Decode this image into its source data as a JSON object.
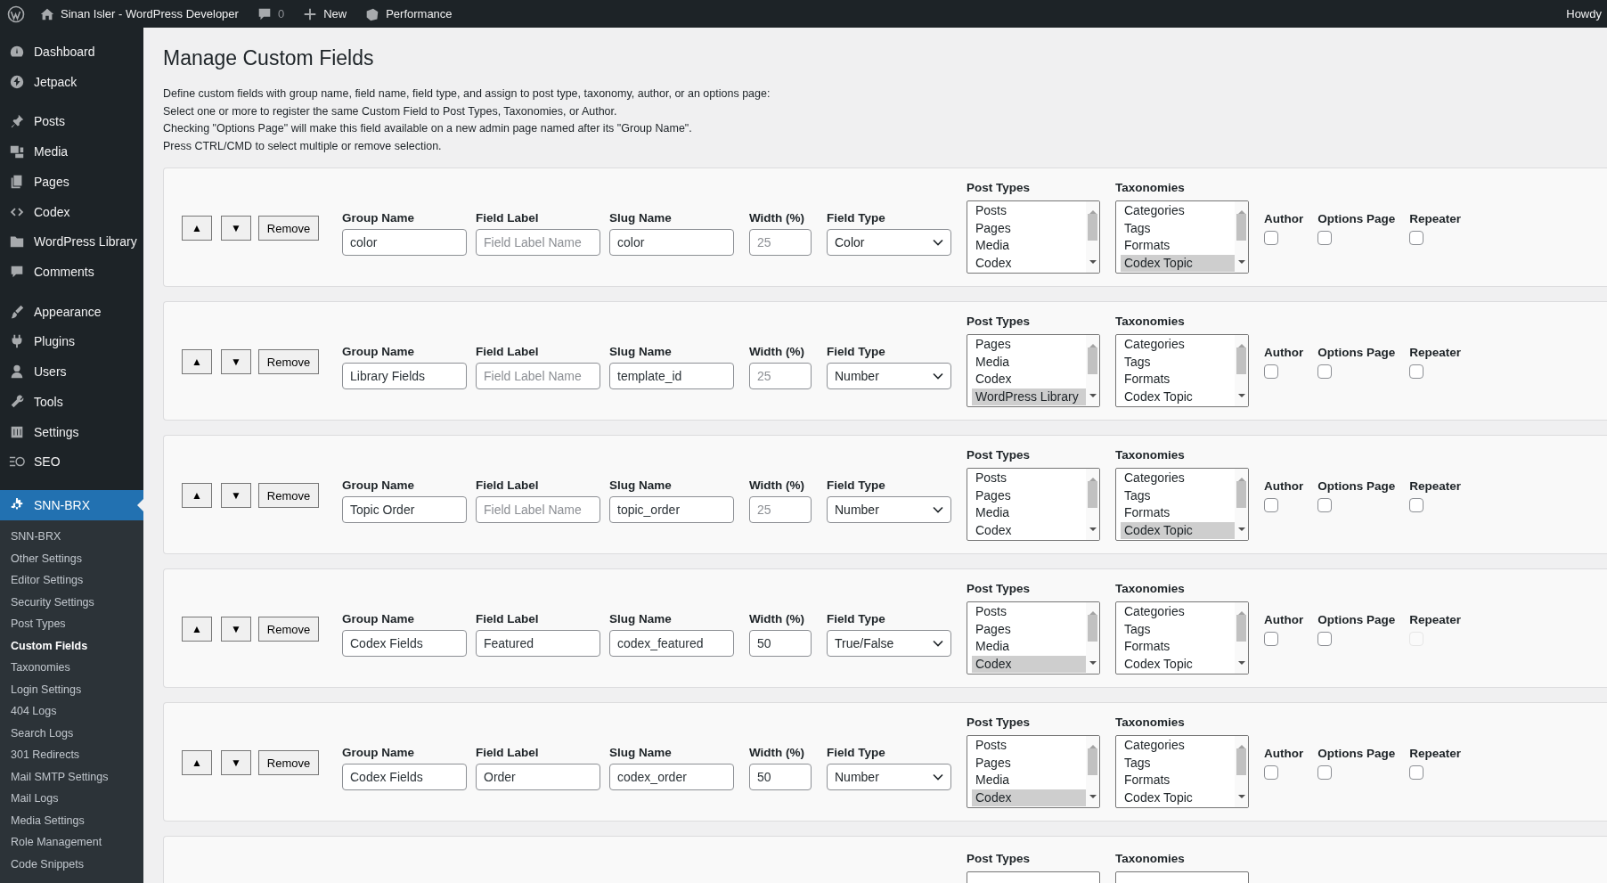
{
  "admin_bar": {
    "site_name": "Sinan Isler - WordPress Developer",
    "comments_count": "0",
    "new_label": "New",
    "performance_label": "Performance",
    "howdy": "Howdy"
  },
  "sidebar": {
    "groups": [
      [
        {
          "label": "Dashboard",
          "kind": "dashboard",
          "selected": false
        },
        {
          "label": "Jetpack",
          "kind": "jetpack",
          "selected": false
        }
      ],
      [
        {
          "label": "Posts",
          "kind": "posts",
          "selected": false
        },
        {
          "label": "Media",
          "kind": "media",
          "selected": false
        },
        {
          "label": "Pages",
          "kind": "pages",
          "selected": false
        },
        {
          "label": "Codex",
          "kind": "codex",
          "selected": false
        },
        {
          "label": "WordPress Library",
          "kind": "library",
          "selected": false
        },
        {
          "label": "Comments",
          "kind": "comments",
          "selected": false
        }
      ],
      [
        {
          "label": "Appearance",
          "kind": "appearance",
          "selected": false
        },
        {
          "label": "Plugins",
          "kind": "plugins",
          "selected": false
        },
        {
          "label": "Users",
          "kind": "users",
          "selected": false
        },
        {
          "label": "Tools",
          "kind": "tools",
          "selected": false
        },
        {
          "label": "Settings",
          "kind": "settings",
          "selected": false
        },
        {
          "label": "SEO",
          "kind": "seo",
          "selected": false
        }
      ],
      [
        {
          "label": "SNN-BRX",
          "kind": "snn",
          "selected": true
        }
      ]
    ],
    "submenu": [
      {
        "label": "SNN-BRX",
        "selected": false
      },
      {
        "label": "Other Settings",
        "selected": false
      },
      {
        "label": "Editor Settings",
        "selected": false
      },
      {
        "label": "Security Settings",
        "selected": false
      },
      {
        "label": "Post Types",
        "selected": false
      },
      {
        "label": "Custom Fields",
        "selected": true
      },
      {
        "label": "Taxonomies",
        "selected": false
      },
      {
        "label": "Login Settings",
        "selected": false
      },
      {
        "label": "404 Logs",
        "selected": false
      },
      {
        "label": "Search Logs",
        "selected": false
      },
      {
        "label": "301 Redirects",
        "selected": false
      },
      {
        "label": "Mail SMTP Settings",
        "selected": false
      },
      {
        "label": "Mail Logs",
        "selected": false
      },
      {
        "label": "Media Settings",
        "selected": false
      },
      {
        "label": "Role Management",
        "selected": false
      },
      {
        "label": "Code Snippets",
        "selected": false
      }
    ]
  },
  "page": {
    "title": "Manage Custom Fields",
    "description": [
      "Define custom fields with group name, field name, field type, and assign to post type, taxonomy, author, or an options page:",
      "Select one or more to register the same Custom Field to Post Types, Taxonomies, or Author.",
      "Checking \"Options Page\" will make this field available on a new admin page named after its \"Group Name\".",
      "Press CTRL/CMD to select multiple or remove selection."
    ]
  },
  "cards": [
    {
      "kind": "full",
      "buttons": {
        "up": "▲",
        "down": "▼",
        "remove": "Remove"
      },
      "labels": {
        "group_name": "Group Name",
        "field_label": "Field Label",
        "slug_name": "Slug Name",
        "width": "Width (%)",
        "field_type": "Field Type",
        "post_types": "Post Types",
        "taxonomies": "Taxonomies",
        "author": "Author",
        "options_page": "Options Page",
        "repeater": "Repeater"
      },
      "group_name": {
        "value": "color"
      },
      "field_label": {
        "placeholder": "Field Label Name"
      },
      "slug_name": {
        "value": "color"
      },
      "width": {
        "placeholder": "25"
      },
      "field_type": "Color",
      "post_types": [
        {
          "label": "Posts",
          "selected": false
        },
        {
          "label": "Pages",
          "selected": false
        },
        {
          "label": "Media",
          "selected": false
        },
        {
          "label": "Codex",
          "selected": false
        }
      ],
      "taxonomies": [
        {
          "label": "Categories",
          "selected": false
        },
        {
          "label": "Tags",
          "selected": false
        },
        {
          "label": "Formats",
          "selected": false
        },
        {
          "label": "Codex Topic",
          "selected": true
        }
      ],
      "author": {
        "checked": false,
        "disabled": false
      },
      "options_page": {
        "checked": false,
        "disabled": false
      },
      "repeater": {
        "checked": false,
        "disabled": false
      }
    },
    {
      "kind": "full",
      "buttons": {
        "up": "▲",
        "down": "▼",
        "remove": "Remove"
      },
      "labels": {
        "group_name": "Group Name",
        "field_label": "Field Label",
        "slug_name": "Slug Name",
        "width": "Width (%)",
        "field_type": "Field Type",
        "post_types": "Post Types",
        "taxonomies": "Taxonomies",
        "author": "Author",
        "options_page": "Options Page",
        "repeater": "Repeater"
      },
      "group_name": {
        "value": "Library Fields"
      },
      "field_label": {
        "placeholder": "Field Label Name"
      },
      "slug_name": {
        "value": "template_id"
      },
      "width": {
        "placeholder": "25"
      },
      "field_type": "Number",
      "post_types": [
        {
          "label": "Pages",
          "selected": false
        },
        {
          "label": "Media",
          "selected": false
        },
        {
          "label": "Codex",
          "selected": false
        },
        {
          "label": "WordPress Library",
          "selected": true
        }
      ],
      "taxonomies": [
        {
          "label": "Categories",
          "selected": false
        },
        {
          "label": "Tags",
          "selected": false
        },
        {
          "label": "Formats",
          "selected": false
        },
        {
          "label": "Codex Topic",
          "selected": false
        }
      ],
      "author": {
        "checked": false,
        "disabled": false
      },
      "options_page": {
        "checked": false,
        "disabled": false
      },
      "repeater": {
        "checked": false,
        "disabled": false
      }
    },
    {
      "kind": "full",
      "buttons": {
        "up": "▲",
        "down": "▼",
        "remove": "Remove"
      },
      "labels": {
        "group_name": "Group Name",
        "field_label": "Field Label",
        "slug_name": "Slug Name",
        "width": "Width (%)",
        "field_type": "Field Type",
        "post_types": "Post Types",
        "taxonomies": "Taxonomies",
        "author": "Author",
        "options_page": "Options Page",
        "repeater": "Repeater"
      },
      "group_name": {
        "value": "Topic Order"
      },
      "field_label": {
        "placeholder": "Field Label Name"
      },
      "slug_name": {
        "value": "topic_order"
      },
      "width": {
        "placeholder": "25"
      },
      "field_type": "Number",
      "post_types": [
        {
          "label": "Posts",
          "selected": false
        },
        {
          "label": "Pages",
          "selected": false
        },
        {
          "label": "Media",
          "selected": false
        },
        {
          "label": "Codex",
          "selected": false
        }
      ],
      "taxonomies": [
        {
          "label": "Categories",
          "selected": false
        },
        {
          "label": "Tags",
          "selected": false
        },
        {
          "label": "Formats",
          "selected": false
        },
        {
          "label": "Codex Topic",
          "selected": true
        }
      ],
      "author": {
        "checked": false,
        "disabled": false
      },
      "options_page": {
        "checked": false,
        "disabled": false
      },
      "repeater": {
        "checked": false,
        "disabled": false
      }
    },
    {
      "kind": "full",
      "buttons": {
        "up": "▲",
        "down": "▼",
        "remove": "Remove"
      },
      "labels": {
        "group_name": "Group Name",
        "field_label": "Field Label",
        "slug_name": "Slug Name",
        "width": "Width (%)",
        "field_type": "Field Type",
        "post_types": "Post Types",
        "taxonomies": "Taxonomies",
        "author": "Author",
        "options_page": "Options Page",
        "repeater": "Repeater"
      },
      "group_name": {
        "value": "Codex Fields"
      },
      "field_label": {
        "value": "Featured"
      },
      "slug_name": {
        "value": "codex_featured"
      },
      "width": {
        "value": "50"
      },
      "field_type": "True/False",
      "post_types": [
        {
          "label": "Posts",
          "selected": false
        },
        {
          "label": "Pages",
          "selected": false
        },
        {
          "label": "Media",
          "selected": false
        },
        {
          "label": "Codex",
          "selected": true
        }
      ],
      "taxonomies": [
        {
          "label": "Categories",
          "selected": false
        },
        {
          "label": "Tags",
          "selected": false
        },
        {
          "label": "Formats",
          "selected": false
        },
        {
          "label": "Codex Topic",
          "selected": false
        }
      ],
      "author": {
        "checked": false,
        "disabled": false
      },
      "options_page": {
        "checked": false,
        "disabled": false
      },
      "repeater": {
        "checked": false,
        "disabled": true
      }
    },
    {
      "kind": "full",
      "buttons": {
        "up": "▲",
        "down": "▼",
        "remove": "Remove"
      },
      "labels": {
        "group_name": "Group Name",
        "field_label": "Field Label",
        "slug_name": "Slug Name",
        "width": "Width (%)",
        "field_type": "Field Type",
        "post_types": "Post Types",
        "taxonomies": "Taxonomies",
        "author": "Author",
        "options_page": "Options Page",
        "repeater": "Repeater"
      },
      "group_name": {
        "value": "Codex Fields"
      },
      "field_label": {
        "value": "Order"
      },
      "slug_name": {
        "value": "codex_order"
      },
      "width": {
        "value": "50"
      },
      "field_type": "Number",
      "post_types": [
        {
          "label": "Posts",
          "selected": false
        },
        {
          "label": "Pages",
          "selected": false
        },
        {
          "label": "Media",
          "selected": false
        },
        {
          "label": "Codex",
          "selected": true
        }
      ],
      "taxonomies": [
        {
          "label": "Categories",
          "selected": false
        },
        {
          "label": "Tags",
          "selected": false
        },
        {
          "label": "Formats",
          "selected": false
        },
        {
          "label": "Codex Topic",
          "selected": false
        }
      ],
      "author": {
        "checked": false,
        "disabled": false
      },
      "options_page": {
        "checked": false,
        "disabled": false
      },
      "repeater": {
        "checked": false,
        "disabled": false
      }
    },
    {
      "kind": "partial",
      "labels": {
        "post_types": "Post Types",
        "taxonomies": "Taxonomies"
      }
    }
  ]
}
